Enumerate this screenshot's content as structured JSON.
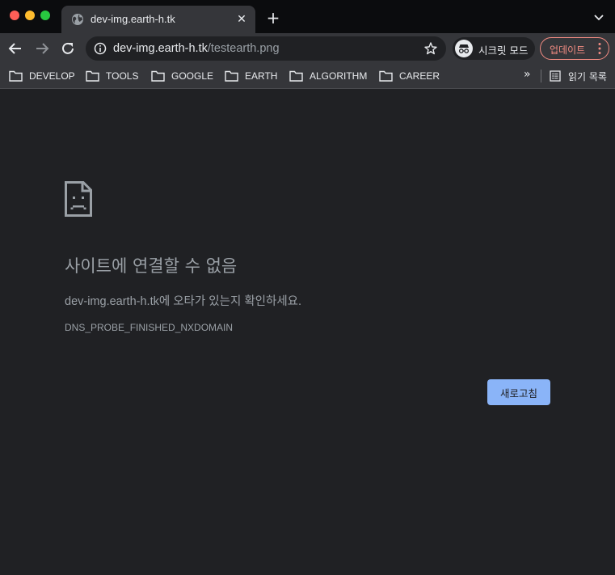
{
  "window": {
    "controls": [
      "close",
      "minimize",
      "maximize"
    ]
  },
  "tab": {
    "title": "dev-img.earth-h.tk",
    "icon": "globe-icon",
    "close_symbol": "✕",
    "new_tab_symbol": "+"
  },
  "toolbar": {
    "url_host": "dev-img.earth-h.tk",
    "url_path": "/testearth.png",
    "incognito_label": "시크릿 모드",
    "update_label": "업데이트"
  },
  "bookmarks": {
    "items": [
      {
        "label": "DEVELOP"
      },
      {
        "label": "TOOLS"
      },
      {
        "label": "GOOGLE"
      },
      {
        "label": "EARTH"
      },
      {
        "label": "ALGORITHM"
      },
      {
        "label": "CAREER"
      }
    ],
    "overflow_symbol": "»",
    "reading_list_label": "읽기 목록"
  },
  "error": {
    "title": "사이트에 연결할 수 없음",
    "message": "dev-img.earth-h.tk에 오타가 있는지 확인하세요.",
    "code": "DNS_PROBE_FINISHED_NXDOMAIN",
    "reload_label": "새로고침"
  },
  "colors": {
    "page_bg": "#202124",
    "toolbar_bg": "#35363a",
    "accent_button": "#8ab4f8",
    "update_accent": "#f28b82",
    "muted_text": "#9aa0a6"
  }
}
